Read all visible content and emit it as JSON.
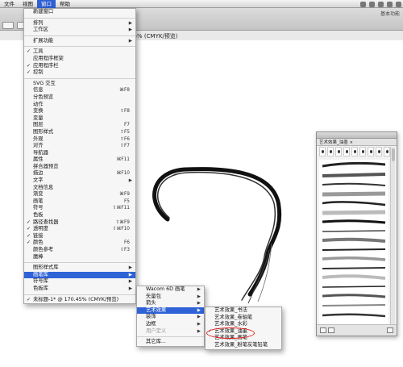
{
  "menubar": {
    "items": [
      "文件",
      "视图",
      "窗口",
      "帮助"
    ],
    "active_index": 2
  },
  "control_bar": {
    "right_label": "基本功能"
  },
  "document": {
    "tab_title": "70.45% (CMYK/预览)"
  },
  "window_menu": {
    "items": [
      {
        "label": "新建窗口",
        "shortcut": "",
        "check": false,
        "submenu": false
      },
      {
        "sep": true
      },
      {
        "label": "排列",
        "shortcut": "",
        "check": false,
        "submenu": true
      },
      {
        "label": "工作区",
        "shortcut": "",
        "check": false,
        "submenu": true
      },
      {
        "sep": true
      },
      {
        "label": "扩展功能",
        "shortcut": "",
        "check": false,
        "submenu": true
      },
      {
        "sep": true
      },
      {
        "label": "工具",
        "shortcut": "",
        "check": true,
        "submenu": false
      },
      {
        "label": "应用程序框架",
        "shortcut": "",
        "check": false,
        "submenu": false
      },
      {
        "label": "应用程序栏",
        "shortcut": "",
        "check": true,
        "submenu": false
      },
      {
        "label": "控制",
        "shortcut": "",
        "check": true,
        "submenu": false
      },
      {
        "sep": true
      },
      {
        "label": "SVG 交互",
        "shortcut": "",
        "check": false,
        "submenu": false
      },
      {
        "label": "信息",
        "shortcut": "⌘F8",
        "check": false,
        "submenu": false
      },
      {
        "label": "分色预览",
        "shortcut": "",
        "check": false,
        "submenu": false
      },
      {
        "label": "动作",
        "shortcut": "",
        "check": false,
        "submenu": false
      },
      {
        "label": "变换",
        "shortcut": "⇧F8",
        "check": false,
        "submenu": false
      },
      {
        "label": "变量",
        "shortcut": "",
        "check": false,
        "submenu": false
      },
      {
        "label": "图层",
        "shortcut": "F7",
        "check": false,
        "submenu": false
      },
      {
        "label": "图形样式",
        "shortcut": "⇧F5",
        "check": false,
        "submenu": false
      },
      {
        "label": "外观",
        "shortcut": "⇧F6",
        "check": false,
        "submenu": false
      },
      {
        "label": "对齐",
        "shortcut": "⇧F7",
        "check": false,
        "submenu": false
      },
      {
        "label": "导航器",
        "shortcut": "",
        "check": false,
        "submenu": false
      },
      {
        "label": "属性",
        "shortcut": "⌘F11",
        "check": false,
        "submenu": false
      },
      {
        "label": "拼合器预览",
        "shortcut": "",
        "check": false,
        "submenu": false
      },
      {
        "label": "描边",
        "shortcut": "⌘F10",
        "check": false,
        "submenu": false
      },
      {
        "label": "文字",
        "shortcut": "",
        "check": false,
        "submenu": true
      },
      {
        "label": "文档信息",
        "shortcut": "",
        "check": false,
        "submenu": false
      },
      {
        "label": "渐变",
        "shortcut": "⌘F9",
        "check": false,
        "submenu": false
      },
      {
        "label": "画笔",
        "shortcut": "F5",
        "check": false,
        "submenu": false
      },
      {
        "label": "符号",
        "shortcut": "⇧⌘F11",
        "check": false,
        "submenu": false
      },
      {
        "label": "色板",
        "shortcut": "",
        "check": false,
        "submenu": false
      },
      {
        "label": "路径查找器",
        "shortcut": "⇧⌘F9",
        "check": true,
        "submenu": false
      },
      {
        "label": "透明度",
        "shortcut": "⇧⌘F10",
        "check": true,
        "submenu": false
      },
      {
        "label": "链接",
        "shortcut": "",
        "check": true,
        "submenu": false
      },
      {
        "label": "颜色",
        "shortcut": "F6",
        "check": true,
        "submenu": false
      },
      {
        "label": "颜色参考",
        "shortcut": "⇧F3",
        "check": false,
        "submenu": false
      },
      {
        "label": "魔棒",
        "shortcut": "",
        "check": false,
        "submenu": false
      },
      {
        "sep": true
      },
      {
        "label": "图形样式库",
        "shortcut": "",
        "check": false,
        "submenu": true
      },
      {
        "label": "画笔库",
        "shortcut": "",
        "check": false,
        "submenu": true,
        "highlight": true
      },
      {
        "label": "符号库",
        "shortcut": "",
        "check": false,
        "submenu": true
      },
      {
        "label": "色板库",
        "shortcut": "",
        "check": false,
        "submenu": true
      },
      {
        "sep": true
      },
      {
        "label": "未标题-1* @ 170.45% (CMYK/预览)",
        "shortcut": "",
        "check": true,
        "submenu": false
      }
    ]
  },
  "brush_library_menu": {
    "items": [
      {
        "label": "Wacom 6D 画笔",
        "submenu": true
      },
      {
        "label": "矢量包",
        "submenu": true
      },
      {
        "label": "箭头",
        "submenu": true
      },
      {
        "label": "艺术效果",
        "submenu": true,
        "highlight": true
      },
      {
        "label": "装饰",
        "submenu": true
      },
      {
        "label": "边框",
        "submenu": true
      },
      {
        "label": "用户定义",
        "submenu": true,
        "dim": true
      },
      {
        "sep": true
      },
      {
        "label": "其它库...",
        "submenu": false
      }
    ]
  },
  "artistic_menu": {
    "items": [
      {
        "label": "艺术效果_书法",
        "check": false
      },
      {
        "label": "艺术效果_卷轴笔",
        "check": false
      },
      {
        "label": "艺术效果_水彩",
        "check": false
      },
      {
        "label": "艺术效果_油墨",
        "check": true
      },
      {
        "label": "艺术效果_画笔",
        "check": false
      },
      {
        "label": "艺术效果_粉笔炭笔铅笔",
        "check": false
      }
    ]
  },
  "brush_panel": {
    "tab_label": "艺术效果_油墨"
  }
}
